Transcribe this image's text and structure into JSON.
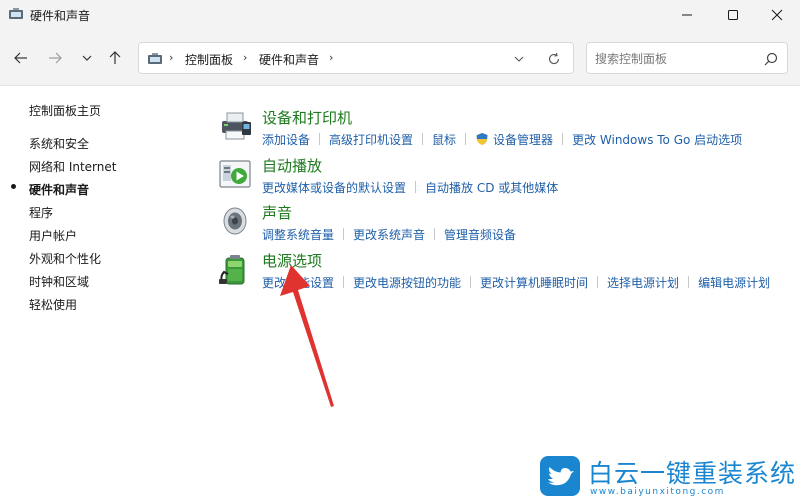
{
  "window": {
    "title": "硬件和声音",
    "icon": "control-panel-icon"
  },
  "navigation": {
    "breadcrumb": [
      "控制面板",
      "硬件和声音"
    ],
    "search_placeholder": "搜索控制面板"
  },
  "sidebar": {
    "items": [
      {
        "label": "控制面板主页",
        "active": false
      },
      {
        "label": "系统和安全",
        "active": false
      },
      {
        "label": "网络和 Internet",
        "active": false
      },
      {
        "label": "硬件和声音",
        "active": true
      },
      {
        "label": "程序",
        "active": false
      },
      {
        "label": "用户帐户",
        "active": false
      },
      {
        "label": "外观和个性化",
        "active": false
      },
      {
        "label": "时钟和区域",
        "active": false
      },
      {
        "label": "轻松使用",
        "active": false
      }
    ]
  },
  "categories": [
    {
      "title": "设备和打印机",
      "icon": "printer-icon",
      "links": [
        "添加设备",
        "高级打印机设置",
        "鼠标",
        "设备管理器",
        "更改 Windows To Go 启动选项"
      ]
    },
    {
      "title": "自动播放",
      "icon": "autoplay-icon",
      "links": [
        "更改媒体或设备的默认设置",
        "自动播放 CD 或其他媒体"
      ]
    },
    {
      "title": "声音",
      "icon": "speaker-icon",
      "links": [
        "调整系统音量",
        "更改系统声音",
        "管理音频设备"
      ]
    },
    {
      "title": "电源选项",
      "icon": "battery-icon",
      "links": [
        "更改节能设置",
        "更改电源按钮的功能",
        "更改计算机睡眠时间",
        "选择电源计划",
        "编辑电源计划"
      ]
    }
  ],
  "watermark": {
    "title": "白云一键重装系统",
    "url": "www.baiyunxitong.com"
  },
  "colors": {
    "category_title": "#1e7a1e",
    "link": "#1f5fa8",
    "annotation_arrow": "#e0322f",
    "watermark": "#1a86d0"
  }
}
